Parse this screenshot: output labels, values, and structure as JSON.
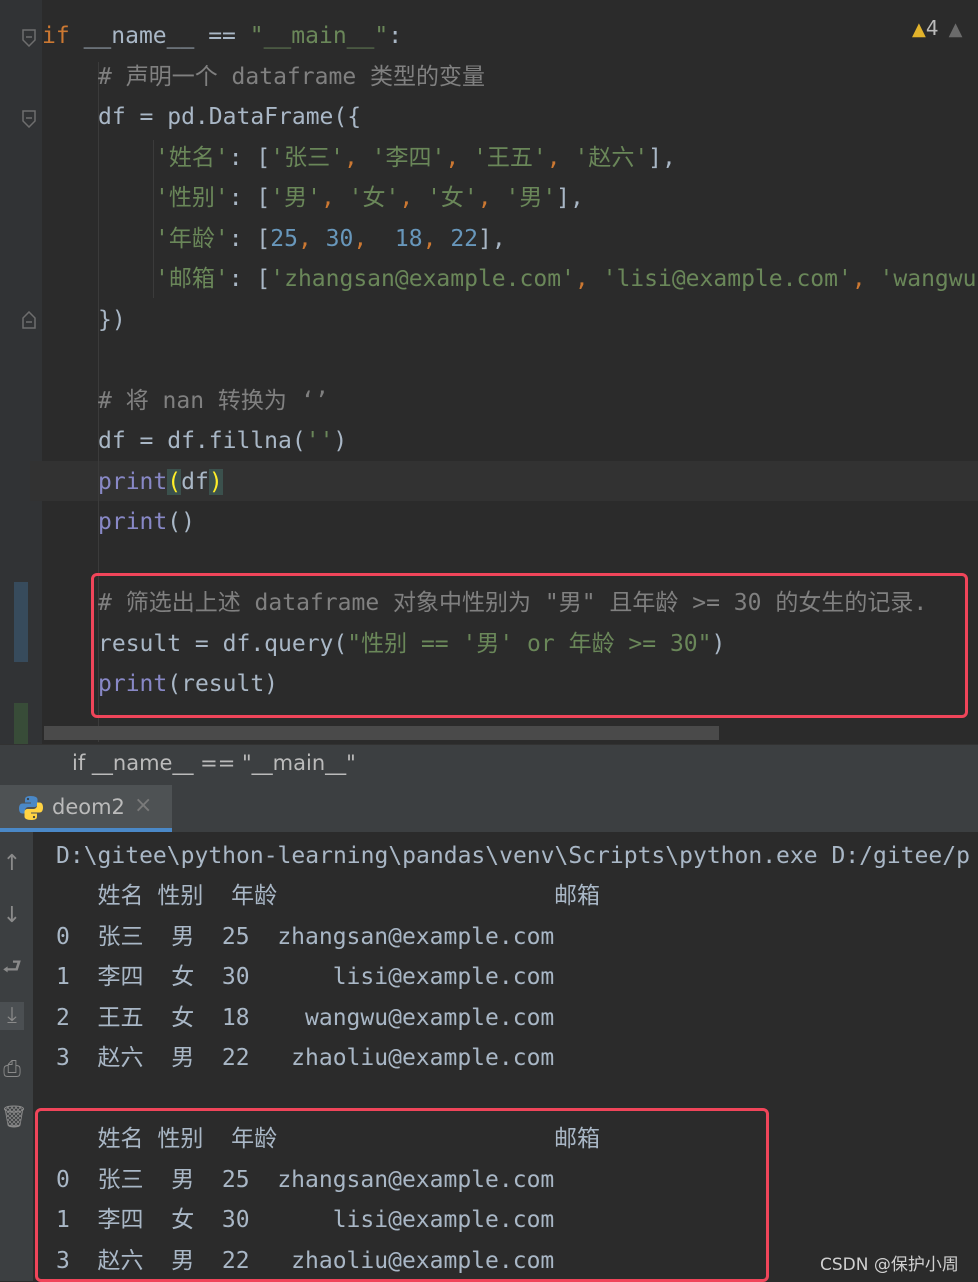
{
  "editor": {
    "warnings_count": "4",
    "lines": {
      "l1_kw": "if",
      "l1_name": "__name__",
      "l1_eq": " == ",
      "l1_str": "\"__main__\"",
      "l1_colon": ":",
      "l2": "# 声明一个 dataframe 类型的变量",
      "l3": "df = pd.DataFrame({",
      "l4_key": "'姓名'",
      "l4_rest": ": [",
      "l4_v1": "'张三'",
      "l4_v2": "'李四'",
      "l4_v3": "'王五'",
      "l4_v4": "'赵六'",
      "l4_end": "],",
      "l5_key": "'性别'",
      "l5_rest": ": [",
      "l5_v1": "'男'",
      "l5_v2": "'女'",
      "l5_v3": "'女'",
      "l5_v4": "'男'",
      "l5_end": "],",
      "l6_key": "'年龄'",
      "l6_rest": ": [",
      "l6_v1": "25",
      "l6_v2": "30",
      "l6_v3": "18",
      "l6_v4": "22",
      "l6_end": "],",
      "l7_key": "'邮箱'",
      "l7_rest": ": [",
      "l7_v1": "'zhangsan@example.com'",
      "l7_v2": "'lisi@example.com'",
      "l7_v3": "'wangwu",
      "l8": "})",
      "l10": "# 将 nan 转换为 ‘’",
      "l11_a": "df = df.fillna(",
      "l11_s": "''",
      "l11_b": ")",
      "l12_fn": "print",
      "l12_p1": "(",
      "l12_arg": "df",
      "l12_p2": ")",
      "l13_fn": "print",
      "l13_rest": "()",
      "l15": "# 筛选出上述 dataframe 对象中性别为 \"男\" 且年龄 >= 30 的女生的记录.",
      "l16_a": "result = df.query(",
      "l16_s": "\"性别 == '男' or 年龄 >= 30\"",
      "l16_b": ")",
      "l17_fn": "print",
      "l17_rest": "(result)"
    }
  },
  "breadcrumb": "if __name__ == \"__main__\"",
  "run_tab": {
    "label": "deom2",
    "close": "×"
  },
  "console": {
    "command": "D:\\gitee\\python-learning\\pandas\\venv\\Scripts\\python.exe D:/gitee/p",
    "table1": {
      "header": "   姓名 性别  年龄                    邮箱",
      "rows": [
        "0  张三  男  25  zhangsan@example.com",
        "1  李四  女  30      lisi@example.com",
        "2  王五  女  18    wangwu@example.com",
        "3  赵六  男  22   zhaoliu@example.com"
      ]
    },
    "table2": {
      "header": "   姓名 性别  年龄                    邮箱",
      "rows": [
        "0  张三  男  25  zhangsan@example.com",
        "1  李四  女  30      lisi@example.com",
        "3  赵六  男  22   zhaoliu@example.com"
      ]
    }
  },
  "watermark": "CSDN @保护小周",
  "colors": {
    "background": "#2b2b2b",
    "keyword": "#cc7832",
    "string": "#6a8759",
    "number": "#6897bb",
    "comment": "#808080",
    "builtin": "#8888c6",
    "highlight_box": "#f0455a"
  }
}
